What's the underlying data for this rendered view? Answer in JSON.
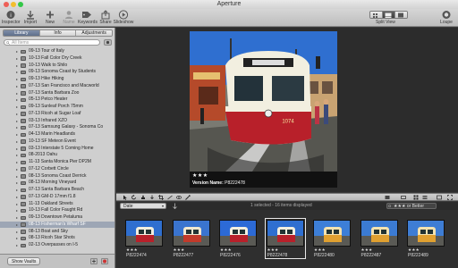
{
  "window": {
    "title": "Aperture"
  },
  "toolbar": {
    "left": [
      {
        "label": "Inspector",
        "icon": "inspector-icon"
      },
      {
        "label": "Import",
        "icon": "import-icon"
      },
      {
        "label": "New",
        "icon": "new-icon"
      },
      {
        "label": "Name",
        "icon": "name-icon"
      },
      {
        "label": "Keywords",
        "icon": "keywords-icon"
      },
      {
        "label": "Share",
        "icon": "share-icon"
      },
      {
        "label": "Slideshow",
        "icon": "slideshow-icon"
      }
    ],
    "view_label": "Split View",
    "loupe_label": "Loupe"
  },
  "sidebar": {
    "tabs": [
      "Library",
      "Info",
      "Adjustments"
    ],
    "search_placeholder": "All Items",
    "items": [
      "09-13 Tour of Italy",
      "10-13 Fall Color Dry Creek",
      "10-13 Walk to Shilo",
      "09-13 Sonoma Coast by Students",
      "09-13 Hike Hiking",
      "07-13 San Francisco and Macworld",
      "07-13 Santa Barbara Zoo",
      "05-13 Petco Heater",
      "09-13 Sunleaf Porch 75mm",
      "07-13 Ricoh at Sugar Loaf",
      "03-13 Infrared XZO",
      "07-13 Samsung Galaxy - Sonoma Co",
      "04-13 Marin Headlands",
      "10-13 SF Meteon Event",
      "03-13 Interstate 5 Coming Home",
      "08-2013 Oahu",
      "11-13 Santa Monica Pier DP2M",
      "07-12 Corbett Circle",
      "08-13 Sonoma Coast Derrick",
      "08-13 Morning Vineyard",
      "07-13 Santa Barbara Beach",
      "07-13 GM-D 17mm f1.8",
      "11-13 Oakland Streets",
      "10-13 Fall Color Faught Rd",
      "09-13 Downtown Petaluma",
      "08-13 Fisherman's Wharf SF",
      "08-13 Boat and Sky",
      "08-13 Ricoh Star Shots",
      "02-13 Overpasses on I-5"
    ],
    "selected_index": 25,
    "show_vaults": "Show Vaults"
  },
  "viewer": {
    "rating": "★★★",
    "version_label": "Version Name:",
    "version_name": "P8222478"
  },
  "browser": {
    "sort": "Date",
    "count": "1 selected - 16 items displayed",
    "rating_filter": "★★★ or Better",
    "thumbs": [
      {
        "name": "P8222474",
        "stars": "★★★"
      },
      {
        "name": "P8222477",
        "stars": "★★★"
      },
      {
        "name": "P8222476",
        "stars": "★★★"
      },
      {
        "name": "P8222478",
        "stars": "★★★"
      },
      {
        "name": "P8222480",
        "stars": "★★★"
      },
      {
        "name": "P8222487",
        "stars": "★★★"
      },
      {
        "name": "P8222489",
        "stars": "★★★"
      }
    ],
    "selected_thumb": 3
  },
  "colors": {
    "selection": "#9da6b5",
    "tram_red": "#b8202a",
    "sky": "#3a7bd5"
  }
}
